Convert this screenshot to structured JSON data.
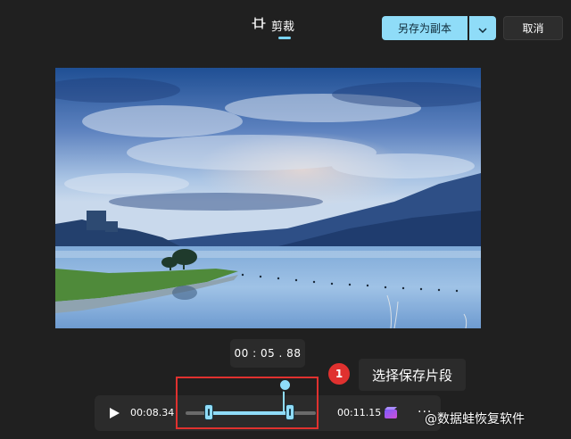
{
  "toolbar": {
    "tab_label": "剪裁",
    "save_copy_label": "另存为副本",
    "cancel_label": "取消",
    "icons": {
      "trim": "trim-icon",
      "dropdown": "chevron-down-icon"
    },
    "accent_color": "#8fdcf8"
  },
  "preview": {
    "current_time": "00 : 05 . 88"
  },
  "annotation": {
    "step_number": "1",
    "callout_text": "选择保存片段",
    "highlight_color": "#e0312f"
  },
  "player": {
    "start_time": "00:08.34",
    "end_time": "00:11.15",
    "more_label": "···",
    "icons": {
      "play": "play-icon",
      "clip": "clip-icon",
      "more": "more-icon"
    },
    "selection": {
      "start_fraction": 0.18,
      "end_fraction": 0.8,
      "playhead_fraction": 0.74
    }
  },
  "watermark": {
    "text": "@数据蛙恢复软件"
  }
}
